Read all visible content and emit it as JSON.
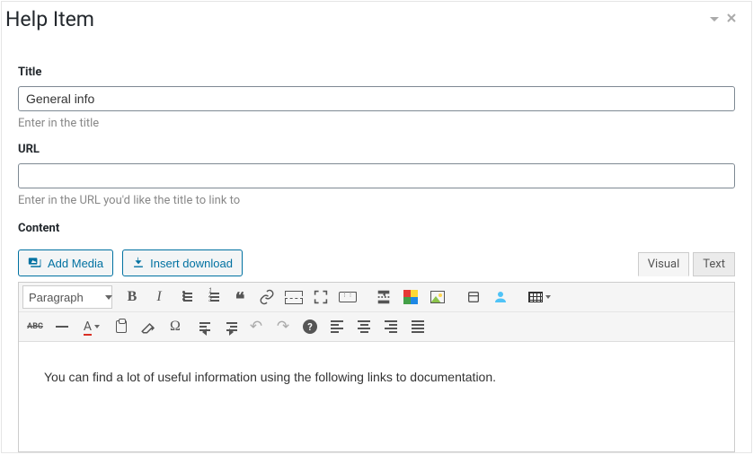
{
  "panel": {
    "title": "Help Item"
  },
  "fields": {
    "title": {
      "label": "Title",
      "value": "General info",
      "hint": "Enter in the title"
    },
    "url": {
      "label": "URL",
      "value": "",
      "hint": "Enter in the URL you'd like the title to link to"
    },
    "content": {
      "label": "Content"
    }
  },
  "buttons": {
    "add_media": "Add Media",
    "insert_download": "Insert download"
  },
  "editor_tabs": {
    "visual": "Visual",
    "text": "Text",
    "active": "visual"
  },
  "format_select": "Paragraph",
  "editor_body": "You can find a lot of useful information using the following links to documentation."
}
